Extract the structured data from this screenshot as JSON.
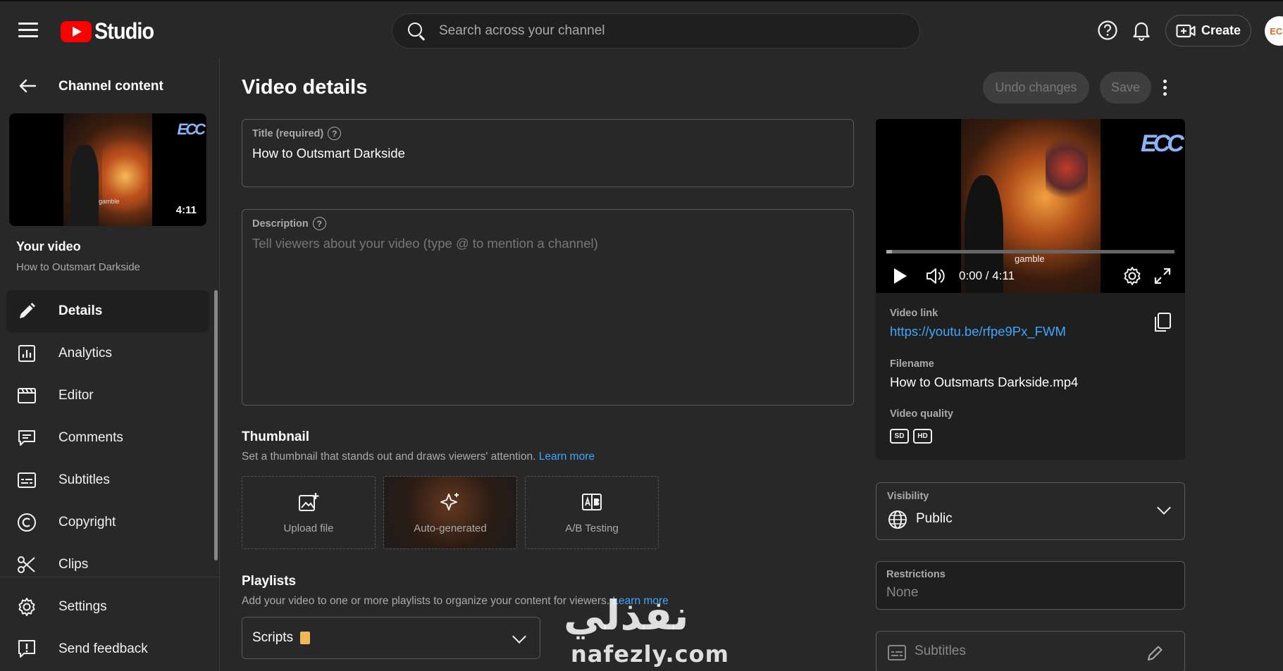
{
  "header": {
    "logo_text": "Studio",
    "search_placeholder": "Search across your channel",
    "create_label": "Create",
    "avatar_text": "ECC"
  },
  "sidebar": {
    "back_label": "Channel content",
    "thumb_duration": "4:11",
    "thumb_caption": "gamble",
    "thumb_logo": "ECC",
    "your_video_label": "Your video",
    "video_title": "How to Outsmart Darkside",
    "items": [
      {
        "label": "Details",
        "icon": "pencil-icon"
      },
      {
        "label": "Analytics",
        "icon": "analytics-icon"
      },
      {
        "label": "Editor",
        "icon": "editor-icon"
      },
      {
        "label": "Comments",
        "icon": "comments-icon"
      },
      {
        "label": "Subtitles",
        "icon": "subtitles-icon"
      },
      {
        "label": "Copyright",
        "icon": "copyright-icon"
      },
      {
        "label": "Clips",
        "icon": "scissors-icon"
      }
    ],
    "bottom_items": [
      {
        "label": "Settings",
        "icon": "gear-icon"
      },
      {
        "label": "Send feedback",
        "icon": "feedback-icon"
      }
    ]
  },
  "main": {
    "page_title": "Video details",
    "undo_label": "Undo changes",
    "save_label": "Save",
    "title_field": {
      "label": "Title (required)",
      "value": "How to Outsmart Darkside"
    },
    "description_field": {
      "label": "Description",
      "placeholder": "Tell viewers about your video (type @ to mention a channel)"
    },
    "thumbnail": {
      "title": "Thumbnail",
      "subtitle": "Set a thumbnail that stands out and draws viewers' attention.",
      "learn_more": "Learn more",
      "options": [
        {
          "label": "Upload file",
          "icon": "upload-image-icon"
        },
        {
          "label": "Auto-generated",
          "icon": "sparkle-icon"
        },
        {
          "label": "A/B Testing",
          "icon": "ab-testing-icon"
        }
      ]
    },
    "playlists": {
      "title": "Playlists",
      "subtitle": "Add your video to one or more playlists to organize your content for viewers.",
      "learn_more": "Learn more",
      "selected": "Scripts"
    }
  },
  "right": {
    "player": {
      "time": "0:00 / 4:11",
      "caption": "gamble",
      "logo": "ECC",
      "progress": 0.02
    },
    "video_link_label": "Video link",
    "video_link": "https://youtu.be/rfpe9Px_FWM",
    "filename_label": "Filename",
    "filename": "How to Outsmarts Darkside.mp4",
    "quality_label": "Video quality",
    "quality_badges": [
      "SD",
      "HD"
    ],
    "visibility_label": "Visibility",
    "visibility_value": "Public",
    "restrictions_label": "Restrictions",
    "restrictions_value": "None",
    "subtitles_label": "Subtitles"
  },
  "watermark": {
    "arabic": "نفذلي",
    "latin": "nafezly.com"
  }
}
